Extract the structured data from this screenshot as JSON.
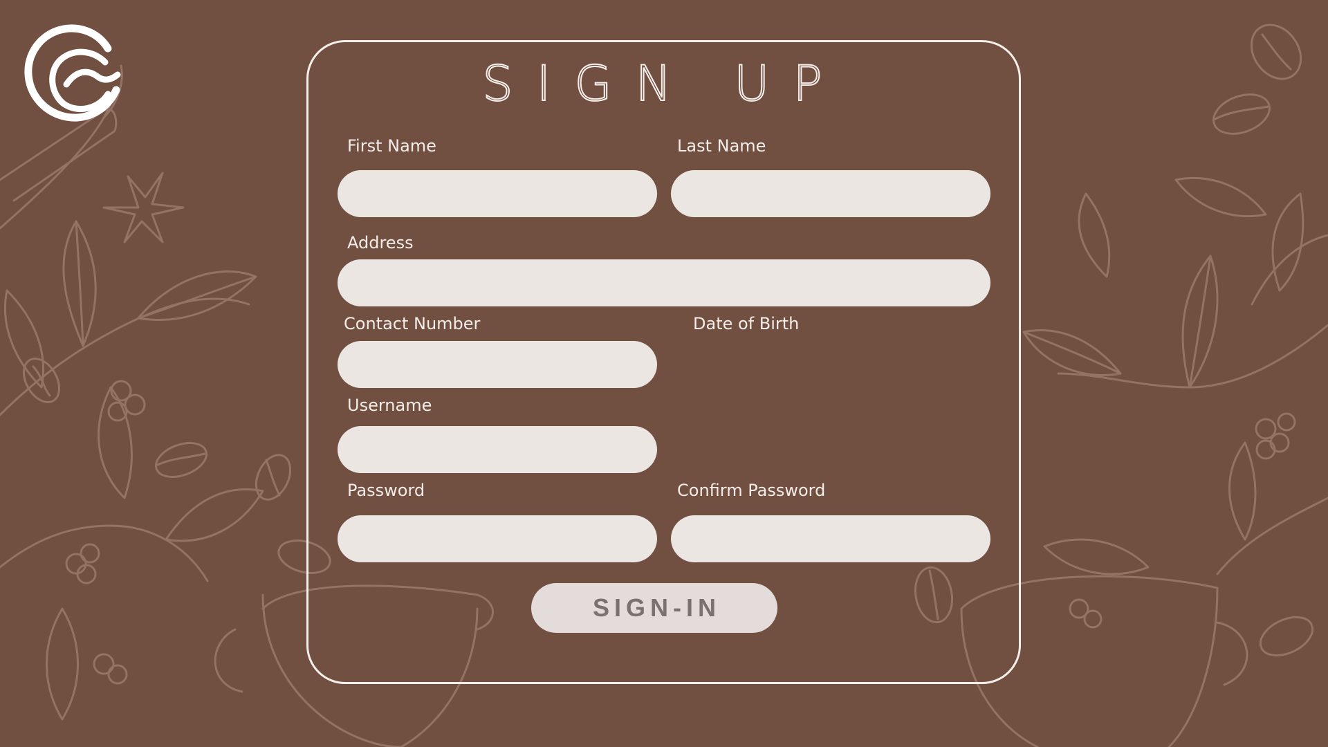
{
  "form": {
    "title": "SIGN UP",
    "fields": {
      "first_name": {
        "label": "First Name",
        "value": "",
        "placeholder": ""
      },
      "last_name": {
        "label": "Last Name",
        "value": "",
        "placeholder": ""
      },
      "address": {
        "label": "Address",
        "value": "",
        "placeholder": ""
      },
      "contact_number": {
        "label": "Contact Number",
        "value": "",
        "placeholder": ""
      },
      "date_of_birth": {
        "label": "Date of Birth"
      },
      "username": {
        "label": "Username",
        "value": "",
        "placeholder": ""
      },
      "password": {
        "label": "Password",
        "value": "",
        "placeholder": ""
      },
      "confirm_password": {
        "label": "Confirm Password",
        "value": "",
        "placeholder": ""
      }
    },
    "submit_label": "SIGN-IN"
  },
  "colors": {
    "background": "#714f41",
    "card_border": "#f5efeb",
    "input_fill": "#ece6e3",
    "button_fill": "#e4dcda",
    "button_text": "#7b716f",
    "label_text": "#f3ece8",
    "doodle_line": "#a07f70"
  },
  "icons": {
    "logo": "brand-logo-icon",
    "background": "coffee-plant-doodles"
  }
}
